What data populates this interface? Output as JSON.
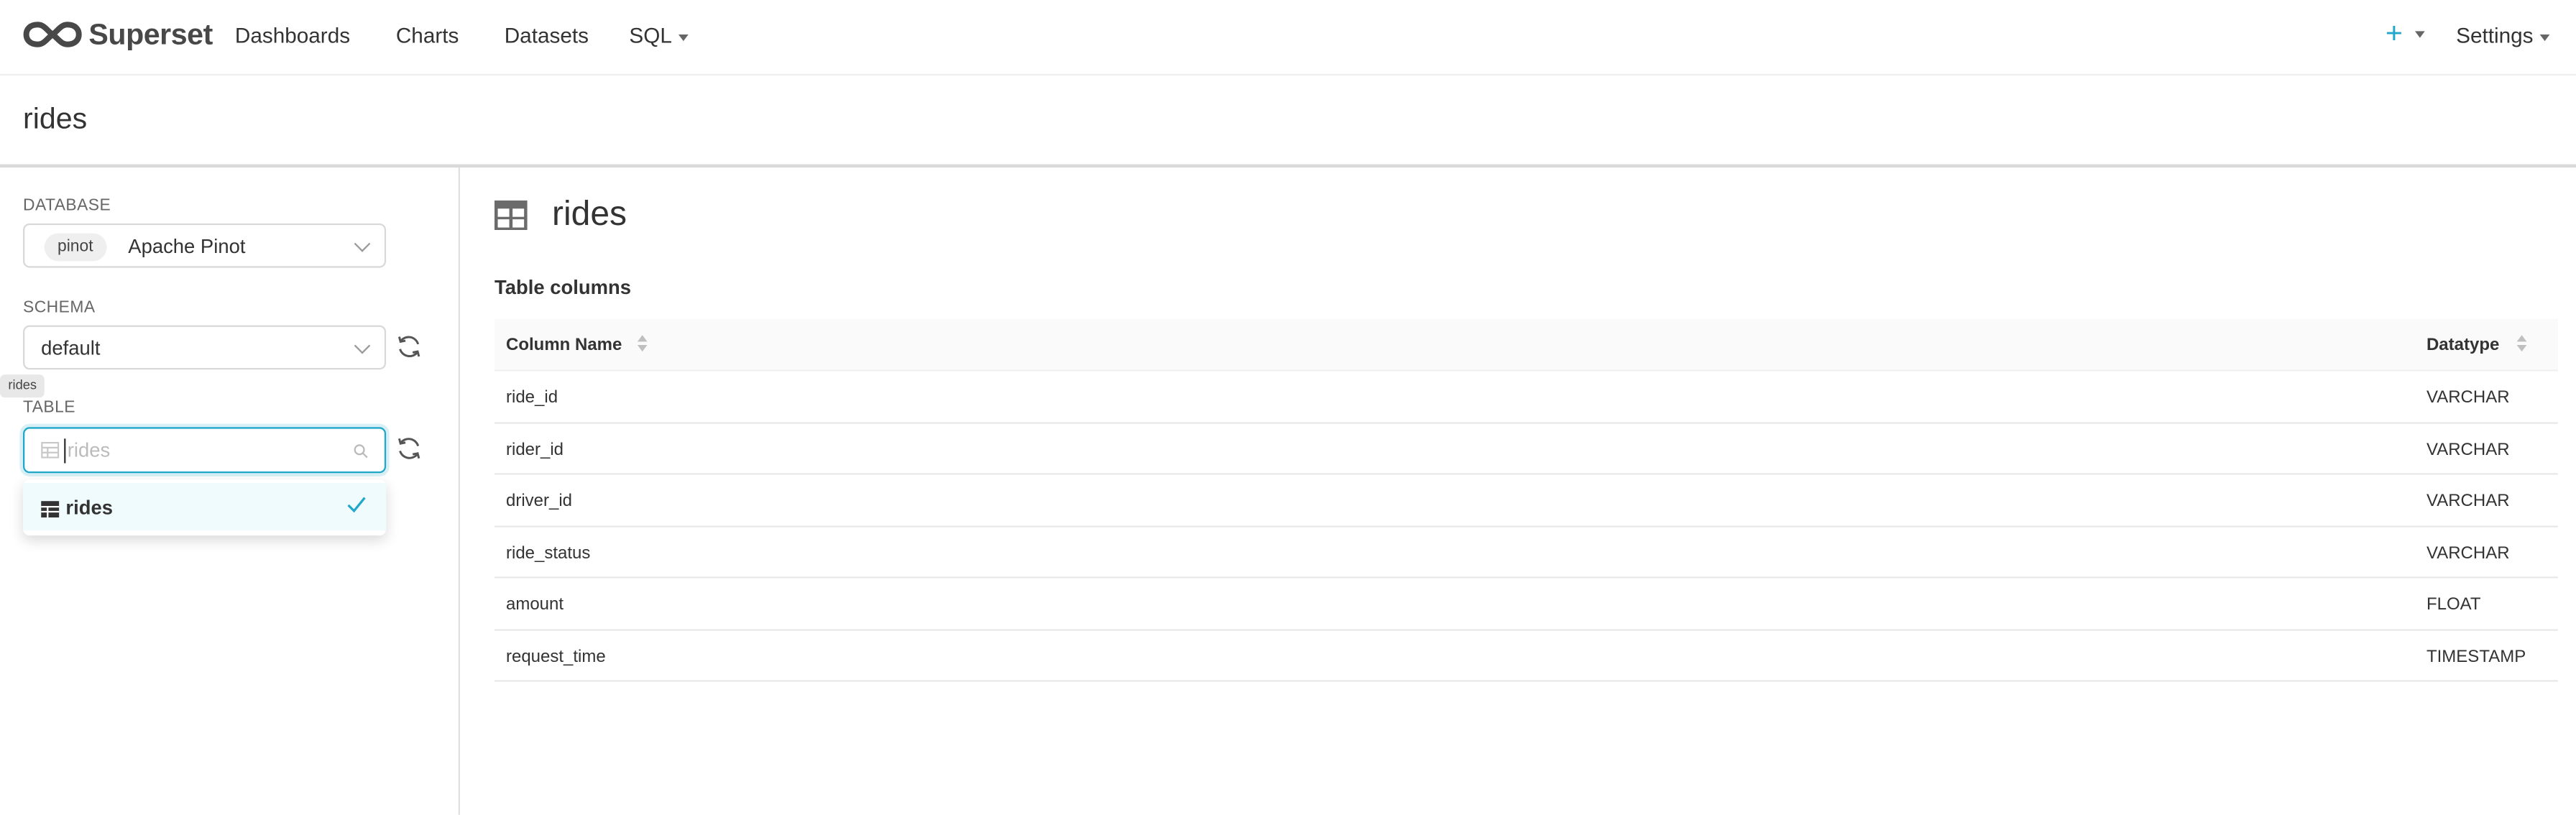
{
  "navbar": {
    "brand": "Superset",
    "items": [
      {
        "label": "Dashboards"
      },
      {
        "label": "Charts"
      },
      {
        "label": "Datasets"
      },
      {
        "label": "SQL"
      }
    ],
    "plus_label": "+",
    "settings_label": "Settings",
    "accent_color": "#20a7c9"
  },
  "page": {
    "title": "rides"
  },
  "left_panel": {
    "database": {
      "label": "DATABASE",
      "tag": "pinot",
      "value": "Apache Pinot"
    },
    "schema": {
      "label": "SCHEMA",
      "value": "default"
    },
    "table": {
      "label": "TABLE",
      "placeholder": "rides",
      "tooltip": "rides"
    },
    "dropdown": {
      "options": [
        {
          "label": "rides",
          "selected": true
        }
      ]
    }
  },
  "main": {
    "title": "rides",
    "section_title": "Table columns",
    "table": {
      "headers": [
        "Column Name",
        "Datatype"
      ],
      "rows": [
        {
          "name": "ride_id",
          "type": "VARCHAR"
        },
        {
          "name": "rider_id",
          "type": "VARCHAR"
        },
        {
          "name": "driver_id",
          "type": "VARCHAR"
        },
        {
          "name": "ride_status",
          "type": "VARCHAR"
        },
        {
          "name": "amount",
          "type": "FLOAT"
        },
        {
          "name": "request_time",
          "type": "TIMESTAMP"
        }
      ]
    }
  }
}
